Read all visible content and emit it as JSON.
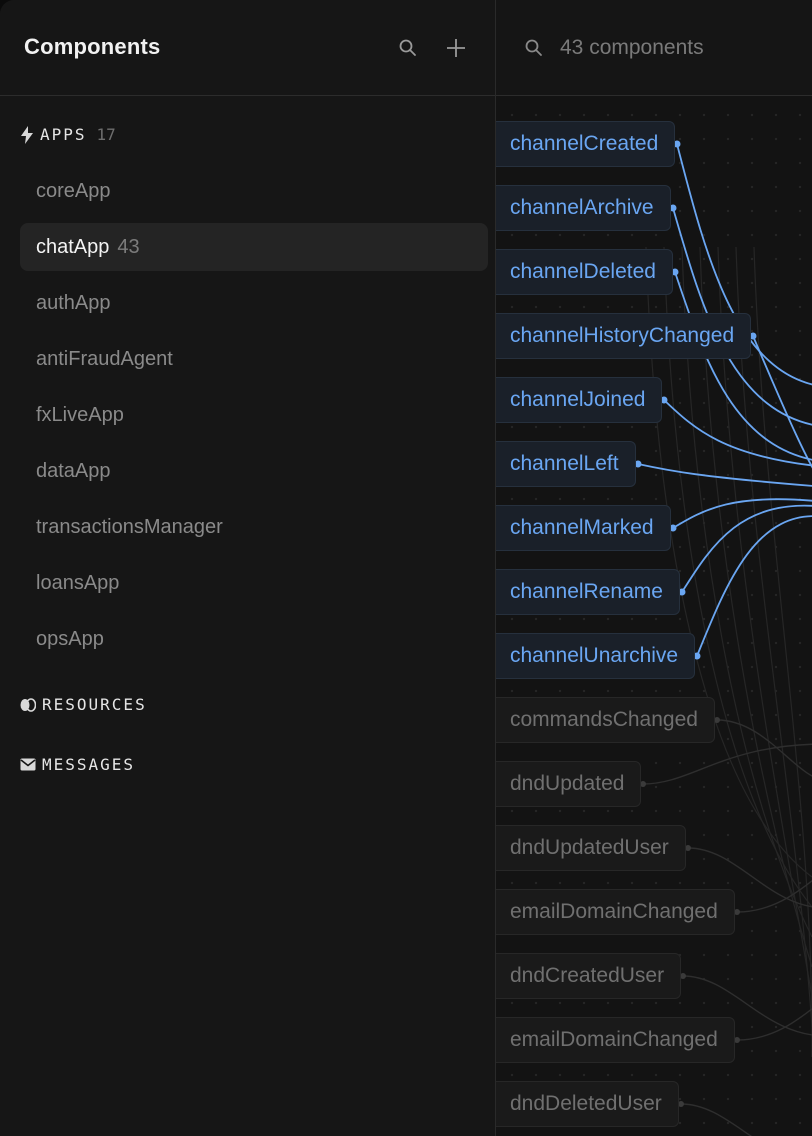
{
  "sidebar": {
    "title": "Components",
    "sections": {
      "apps": {
        "label": "APPS",
        "count": "17"
      },
      "resources": {
        "label": "RESOURCES"
      },
      "messages": {
        "label": "MESSAGES"
      }
    },
    "apps": [
      {
        "name": "coreApp",
        "count": ""
      },
      {
        "name": "chatApp",
        "count": "43"
      },
      {
        "name": "authApp",
        "count": ""
      },
      {
        "name": "antiFraudAgent",
        "count": ""
      },
      {
        "name": "fxLiveApp",
        "count": ""
      },
      {
        "name": "dataApp",
        "count": ""
      },
      {
        "name": "transactionsManager",
        "count": ""
      },
      {
        "name": "loansApp",
        "count": ""
      },
      {
        "name": "opsApp",
        "count": ""
      }
    ],
    "icons": {
      "search": "search-icon",
      "add": "plus-icon",
      "apps": "bolt-icon",
      "resources": "database-icon",
      "messages": "mail-icon"
    }
  },
  "main": {
    "search_text": "43 components",
    "nodes": [
      {
        "label": "channelCreated",
        "highlighted": true
      },
      {
        "label": "channelArchive",
        "highlighted": true
      },
      {
        "label": "channelDeleted",
        "highlighted": true
      },
      {
        "label": "channelHistoryChanged",
        "highlighted": true
      },
      {
        "label": "channelJoined",
        "highlighted": true
      },
      {
        "label": "channelLeft",
        "highlighted": true
      },
      {
        "label": "channelMarked",
        "highlighted": true
      },
      {
        "label": "channelRename",
        "highlighted": true
      },
      {
        "label": "channelUnarchive",
        "highlighted": true
      },
      {
        "label": "commandsChanged",
        "highlighted": false
      },
      {
        "label": "dndUpdated",
        "highlighted": false
      },
      {
        "label": "dndUpdatedUser",
        "highlighted": false
      },
      {
        "label": "emailDomainChanged",
        "highlighted": false
      },
      {
        "label": "dndCreatedUser",
        "highlighted": false
      },
      {
        "label": "emailDomainChanged",
        "highlighted": false
      },
      {
        "label": "dndDeletedUser",
        "highlighted": false
      }
    ]
  },
  "colors": {
    "accent": "#6aa6f2",
    "background": "#151515",
    "text_dim": "#707070"
  }
}
